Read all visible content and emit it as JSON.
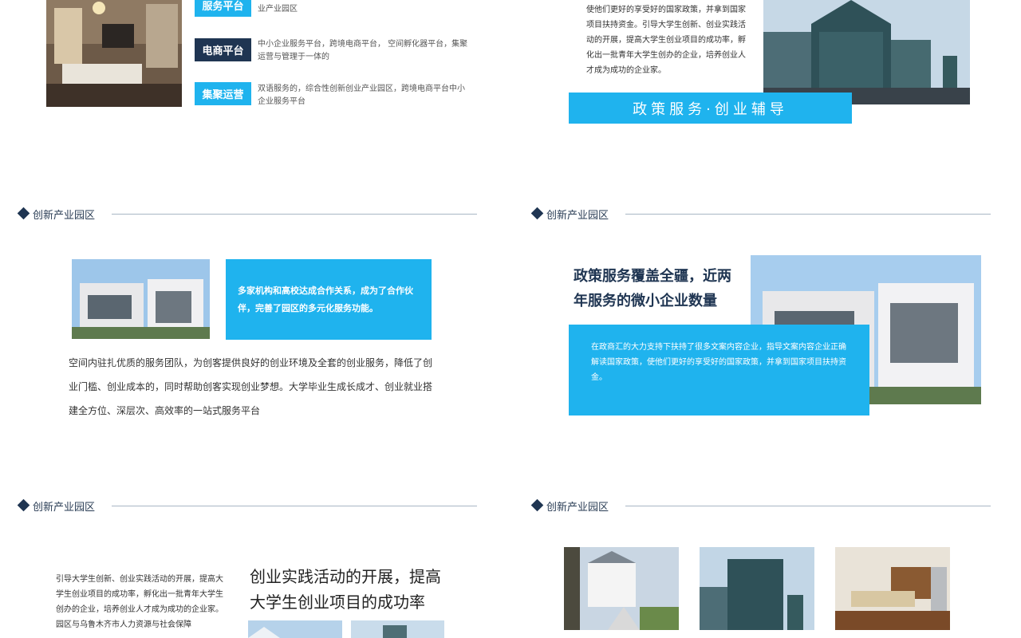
{
  "section_title": "创新产业园区",
  "top_left": {
    "tags": [
      {
        "label": "服务平台",
        "desc": "业产业园区"
      },
      {
        "label": "电商平台",
        "desc": "中小企业服务平台，跨境电商平台， 空间孵化器平台，集聚运营与管理于一体的"
      },
      {
        "label": "集聚运营",
        "desc": "双语服务的，综合性创新创业产业园区，跨境电商平台中小企业服务平台"
      }
    ]
  },
  "top_right": {
    "paragraph": "使他们更好的享受好的国家政策，并拿到国家项目扶持资金。引导大学生创新、创业实践活动的开展，提高大学生创业项目的成功率，孵化出一批青年大学生创办的企业，培养创业人才成为成功的企业家。",
    "banner": "政策服务·创业辅导"
  },
  "mid_left": {
    "box_text": "多家机构和高校达成合作关系，成为了合作伙伴，完善了园区的多元化服务功能。",
    "paragraph": "空间内驻扎优质的服务团队，为创客提供良好的创业环境及全套的创业服务，降低了创业门槛、创业成本的，同时帮助创客实现创业梦想。大学毕业生成长成才、创业就业搭建全方位、深层次、高效率的一站式服务平台"
  },
  "mid_right": {
    "heading": "政策服务覆盖全疆，近两年服务的微小企业数量",
    "box_text": "在政商汇的大力支持下扶持了很多文案内容企业，指导文案内容企业正确解读国家政策，使他们更好的享受好的国家政策，并拿到国家项目扶持资金。"
  },
  "bottom_left": {
    "paragraph": "引导大学生创新、创业实践活动的开展，提高大学生创业项目的成功率，孵化出一批青年大学生创办的企业，培养创业人才成为成功的企业家。园区与乌鲁木齐市人力资源与社会保障",
    "heading": "创业实践活动的开展，提高大学生创业项目的成功率"
  },
  "colors": {
    "accent": "#1fb3ee",
    "navy": "#1f3552",
    "rule": "#a9b6c4"
  }
}
